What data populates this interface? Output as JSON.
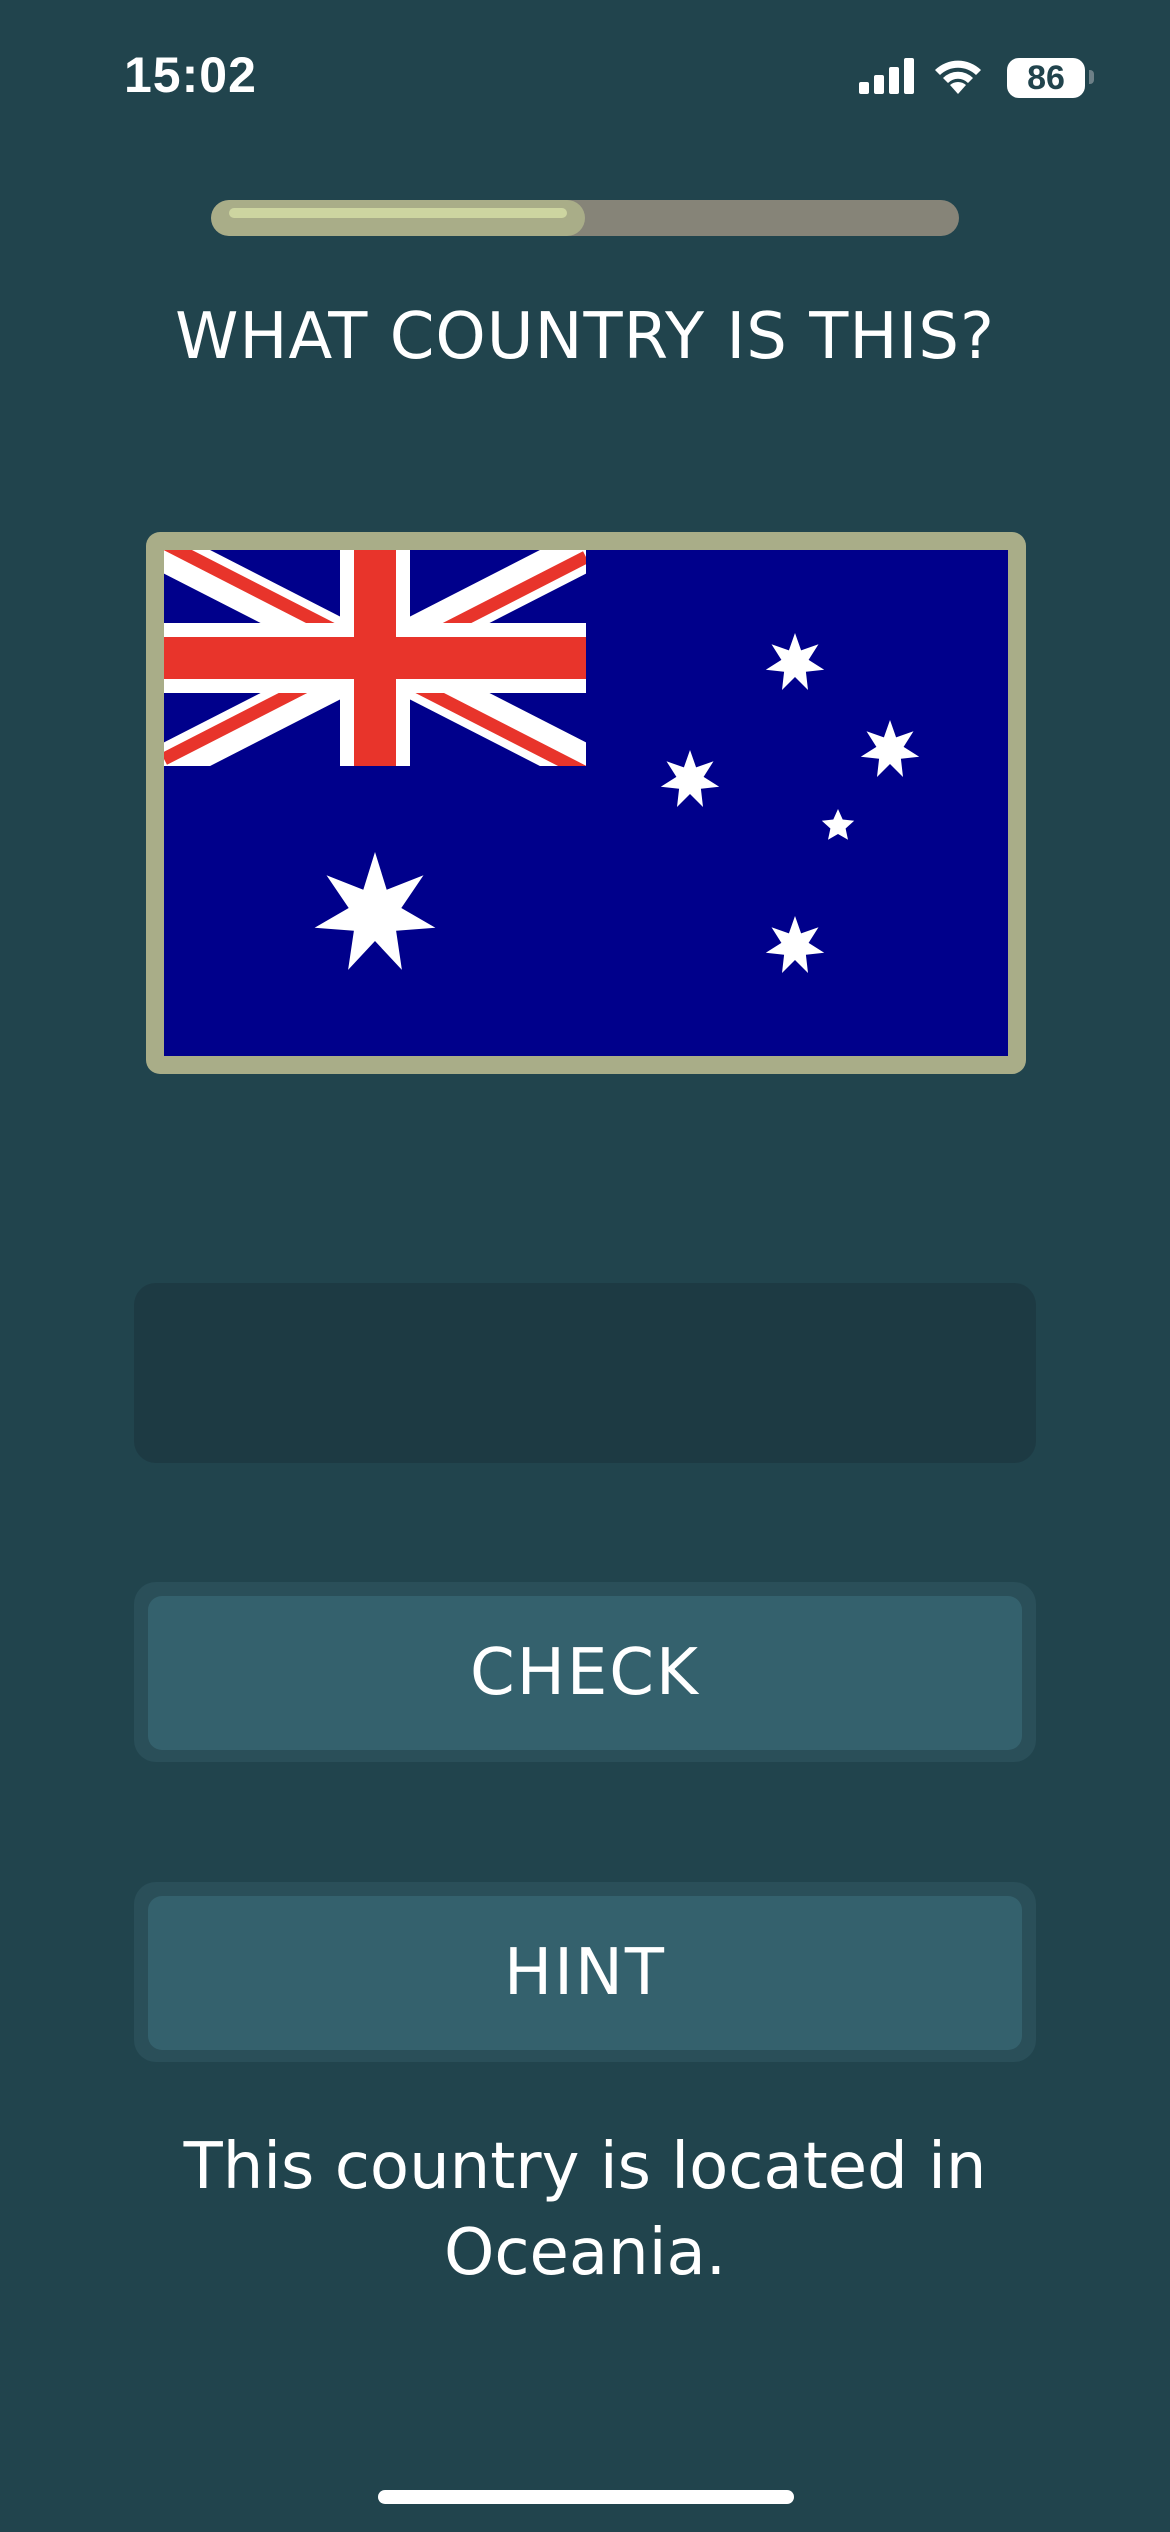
{
  "status_bar": {
    "time": "15:02",
    "battery": "86",
    "icons": [
      "signal-icon",
      "wifi-icon",
      "battery-icon"
    ]
  },
  "progress": {
    "fraction": 0.5
  },
  "question": {
    "text": "WHAT COUNTRY IS THIS?"
  },
  "flag": {
    "icon": "australia-flag-icon",
    "colors": {
      "blue": "#00008b",
      "red": "#e8342b",
      "white": "#ffffff",
      "frame": "#a9ad88"
    }
  },
  "answer": {
    "value": "",
    "placeholder": ""
  },
  "buttons": {
    "check_label": "CHECK",
    "hint_label": "HINT"
  },
  "hint": {
    "text": "This country is located in Oceania."
  },
  "colors": {
    "background": "#21444d",
    "button": "#34616d",
    "field": "#1d3a43"
  }
}
